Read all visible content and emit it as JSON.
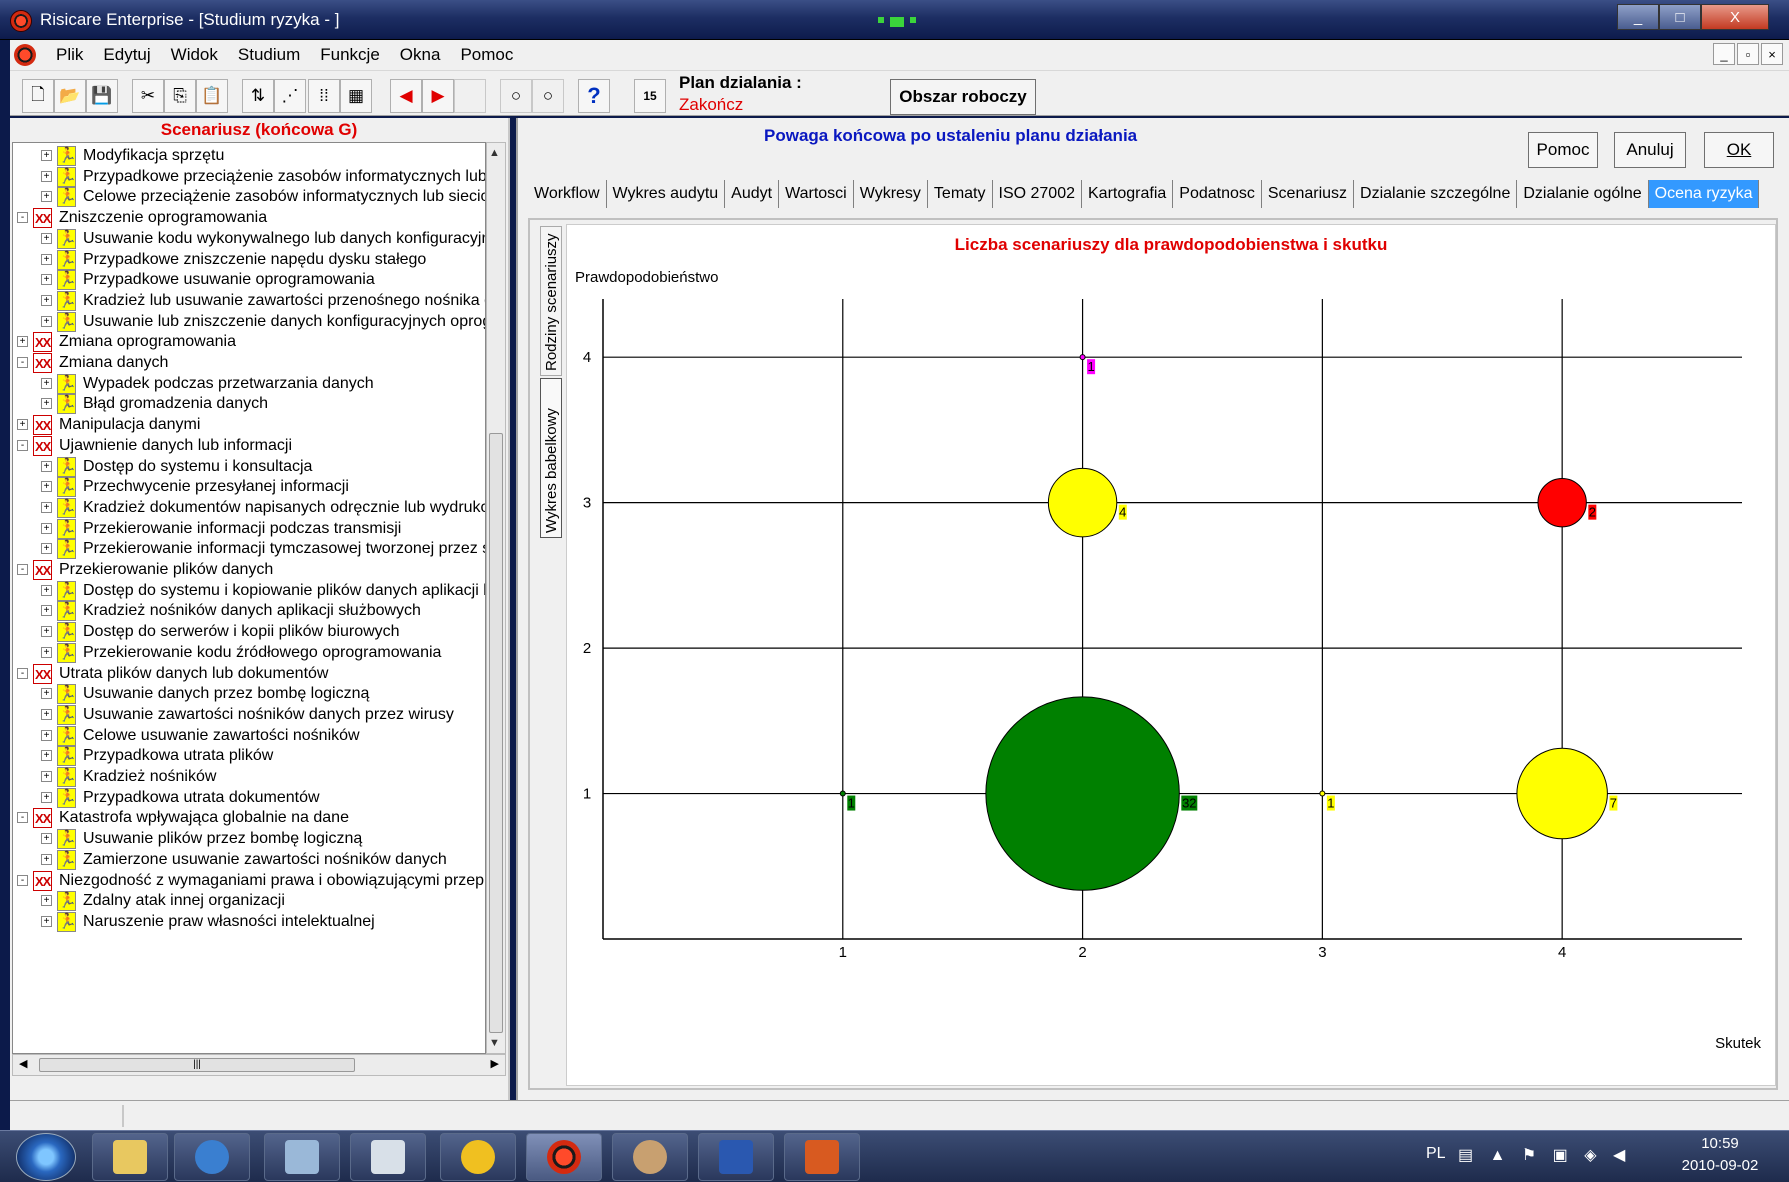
{
  "window": {
    "title": "Risicare Enterprise - [Studium ryzyka - ]",
    "buttons": [
      "_",
      "□",
      "X"
    ],
    "mdi_buttons": [
      "_",
      "▫",
      "×"
    ]
  },
  "menu": [
    "Plik",
    "Edytuj",
    "Widok",
    "Studium",
    "Funkcje",
    "Okna",
    "Pomoc"
  ],
  "toolbar": {
    "plan_label": "Plan dzialania :",
    "plan_value": "Zakończ",
    "workspace_button": "Obszar roboczy",
    "calendar_number": "15",
    "help_glyph": "?"
  },
  "tree": {
    "header": "Scenariusz (końcowa G)",
    "items": [
      {
        "level": 1,
        "type": "child",
        "expander": "+",
        "label": "Modyfikacja sprzętu"
      },
      {
        "level": 1,
        "type": "child",
        "expander": "+",
        "label": "Przypadkowe przeciążenie zasobów informatycznych lub sieciowych"
      },
      {
        "level": 1,
        "type": "child",
        "expander": "+",
        "label": "Celowe przeciążenie zasobów informatycznych lub sieciowych"
      },
      {
        "level": 0,
        "type": "family",
        "expander": "-",
        "label": "Zniszczenie oprogramowania"
      },
      {
        "level": 1,
        "type": "child",
        "expander": "+",
        "label": "Usuwanie kodu wykonywalnego lub danych konfiguracyjnych"
      },
      {
        "level": 1,
        "type": "child",
        "expander": "+",
        "label": "Przypadkowe zniszczenie napędu dysku stałego"
      },
      {
        "level": 1,
        "type": "child",
        "expander": "+",
        "label": "Przypadkowe usuwanie oprogramowania"
      },
      {
        "level": 1,
        "type": "child",
        "expander": "+",
        "label": "Kradzież lub usuwanie zawartości przenośnego nośnika danych"
      },
      {
        "level": 1,
        "type": "child",
        "expander": "+",
        "label": "Usuwanie lub zniszczenie danych konfiguracyjnych oprogramowania"
      },
      {
        "level": 0,
        "type": "family",
        "expander": "+",
        "label": "Zmiana oprogramowania"
      },
      {
        "level": 0,
        "type": "family",
        "expander": "-",
        "label": "Zmiana danych"
      },
      {
        "level": 1,
        "type": "child",
        "expander": "+",
        "label": "Wypadek podczas przetwarzania danych"
      },
      {
        "level": 1,
        "type": "child",
        "expander": "+",
        "label": "Błąd gromadzenia danych"
      },
      {
        "level": 0,
        "type": "family",
        "expander": "+",
        "label": "Manipulacja danymi"
      },
      {
        "level": 0,
        "type": "family",
        "expander": "-",
        "label": "Ujawnienie danych lub informacji"
      },
      {
        "level": 1,
        "type": "child",
        "expander": "+",
        "label": "Dostęp do systemu i konsultacja"
      },
      {
        "level": 1,
        "type": "child",
        "expander": "+",
        "label": "Przechwycenie przesyłanej informacji"
      },
      {
        "level": 1,
        "type": "child",
        "expander": "+",
        "label": "Kradzież dokumentów napisanych odręcznie lub wydrukowanych"
      },
      {
        "level": 1,
        "type": "child",
        "expander": "+",
        "label": "Przekierowanie informacji podczas transmisji"
      },
      {
        "level": 1,
        "type": "child",
        "expander": "+",
        "label": "Przekierowanie informacji tymczasowej tworzonej przez system"
      },
      {
        "level": 0,
        "type": "family",
        "expander": "-",
        "label": "Przekierowanie plików danych"
      },
      {
        "level": 1,
        "type": "child",
        "expander": "+",
        "label": "Dostęp do systemu i kopiowanie plików danych aplikacji biznesowych"
      },
      {
        "level": 1,
        "type": "child",
        "expander": "+",
        "label": "Kradzież nośników danych aplikacji służbowych"
      },
      {
        "level": 1,
        "type": "child",
        "expander": "+",
        "label": "Dostęp do serwerów i kopii plików biurowych"
      },
      {
        "level": 1,
        "type": "child",
        "expander": "+",
        "label": "Przekierowanie kodu źródłowego oprogramowania"
      },
      {
        "level": 0,
        "type": "family",
        "expander": "-",
        "label": "Utrata plików danych lub dokumentów"
      },
      {
        "level": 1,
        "type": "child",
        "expander": "+",
        "label": "Usuwanie danych przez bombę logiczną"
      },
      {
        "level": 1,
        "type": "child",
        "expander": "+",
        "label": "Usuwanie zawartości nośników danych przez wirusy"
      },
      {
        "level": 1,
        "type": "child",
        "expander": "+",
        "label": "Celowe usuwanie zawartości nośników"
      },
      {
        "level": 1,
        "type": "child",
        "expander": "+",
        "label": "Przypadkowa utrata plików"
      },
      {
        "level": 1,
        "type": "child",
        "expander": "+",
        "label": "Kradzież nośników"
      },
      {
        "level": 1,
        "type": "child",
        "expander": "+",
        "label": "Przypadkowa utrata dokumentów"
      },
      {
        "level": 0,
        "type": "family",
        "expander": "-",
        "label": "Katastrofa wpływająca globalnie na dane"
      },
      {
        "level": 1,
        "type": "child",
        "expander": "+",
        "label": "Usuwanie plików przez bombę logiczną"
      },
      {
        "level": 1,
        "type": "child",
        "expander": "+",
        "label": "Zamierzone usuwanie zawartości nośników danych"
      },
      {
        "level": 0,
        "type": "family",
        "expander": "-",
        "label": "Niezgodność z wymaganiami prawa i obowiązującymi przepisami"
      },
      {
        "level": 1,
        "type": "child",
        "expander": "+",
        "label": "Zdalny atak innej organizacji"
      },
      {
        "level": 1,
        "type": "child",
        "expander": "+",
        "label": "Naruszenie praw własności intelektualnej"
      }
    ]
  },
  "panel": {
    "title": "Powaga końcowa po ustaleniu planu działania",
    "buttons": {
      "help": "Pomoc",
      "cancel": "Anuluj",
      "ok": "OK"
    }
  },
  "tabs": [
    "Workflow",
    "Wykres audytu",
    "Audyt",
    "Wartosci",
    "Wykresy",
    "Tematy",
    "ISO 27002",
    "Kartografia",
    "Podatnosc",
    "Scenariusz",
    "Dzialanie szczególne",
    "Dzialanie ogólne",
    "Ocena ryzyka"
  ],
  "active_tab": "Ocena ryzyka",
  "vertical_tabs": [
    "Rodziny scenariuszy",
    "Wykres babelkowy"
  ],
  "chart_data": {
    "type": "scatter",
    "subtype": "bubble",
    "title": "Liczba scenariuszy dla prawdopodobienstwa i skutku",
    "xlabel": "Skutek",
    "ylabel": "Prawdopodobieństwo",
    "x_ticks": [
      "1",
      "2",
      "3",
      "4"
    ],
    "y_ticks": [
      "1",
      "2",
      "3",
      "4"
    ],
    "xlim": [
      0,
      4.75
    ],
    "ylim": [
      0,
      4.4
    ],
    "grid": true,
    "points": [
      {
        "x": 2,
        "y": 4,
        "count": 1,
        "color": "#ff00ff"
      },
      {
        "x": 2,
        "y": 3,
        "count": 4,
        "color": "#ffff00"
      },
      {
        "x": 4,
        "y": 3,
        "count": 2,
        "color": "#ff0000"
      },
      {
        "x": 1,
        "y": 1,
        "count": 1,
        "color": "#008000"
      },
      {
        "x": 2,
        "y": 1,
        "count": 32,
        "color": "#008000"
      },
      {
        "x": 3,
        "y": 1,
        "count": 1,
        "color": "#ffff00"
      },
      {
        "x": 4,
        "y": 1,
        "count": 7,
        "color": "#ffff00"
      }
    ]
  },
  "taskbar": {
    "language": "PL",
    "time": "10:59",
    "date": "2010-09-02"
  }
}
